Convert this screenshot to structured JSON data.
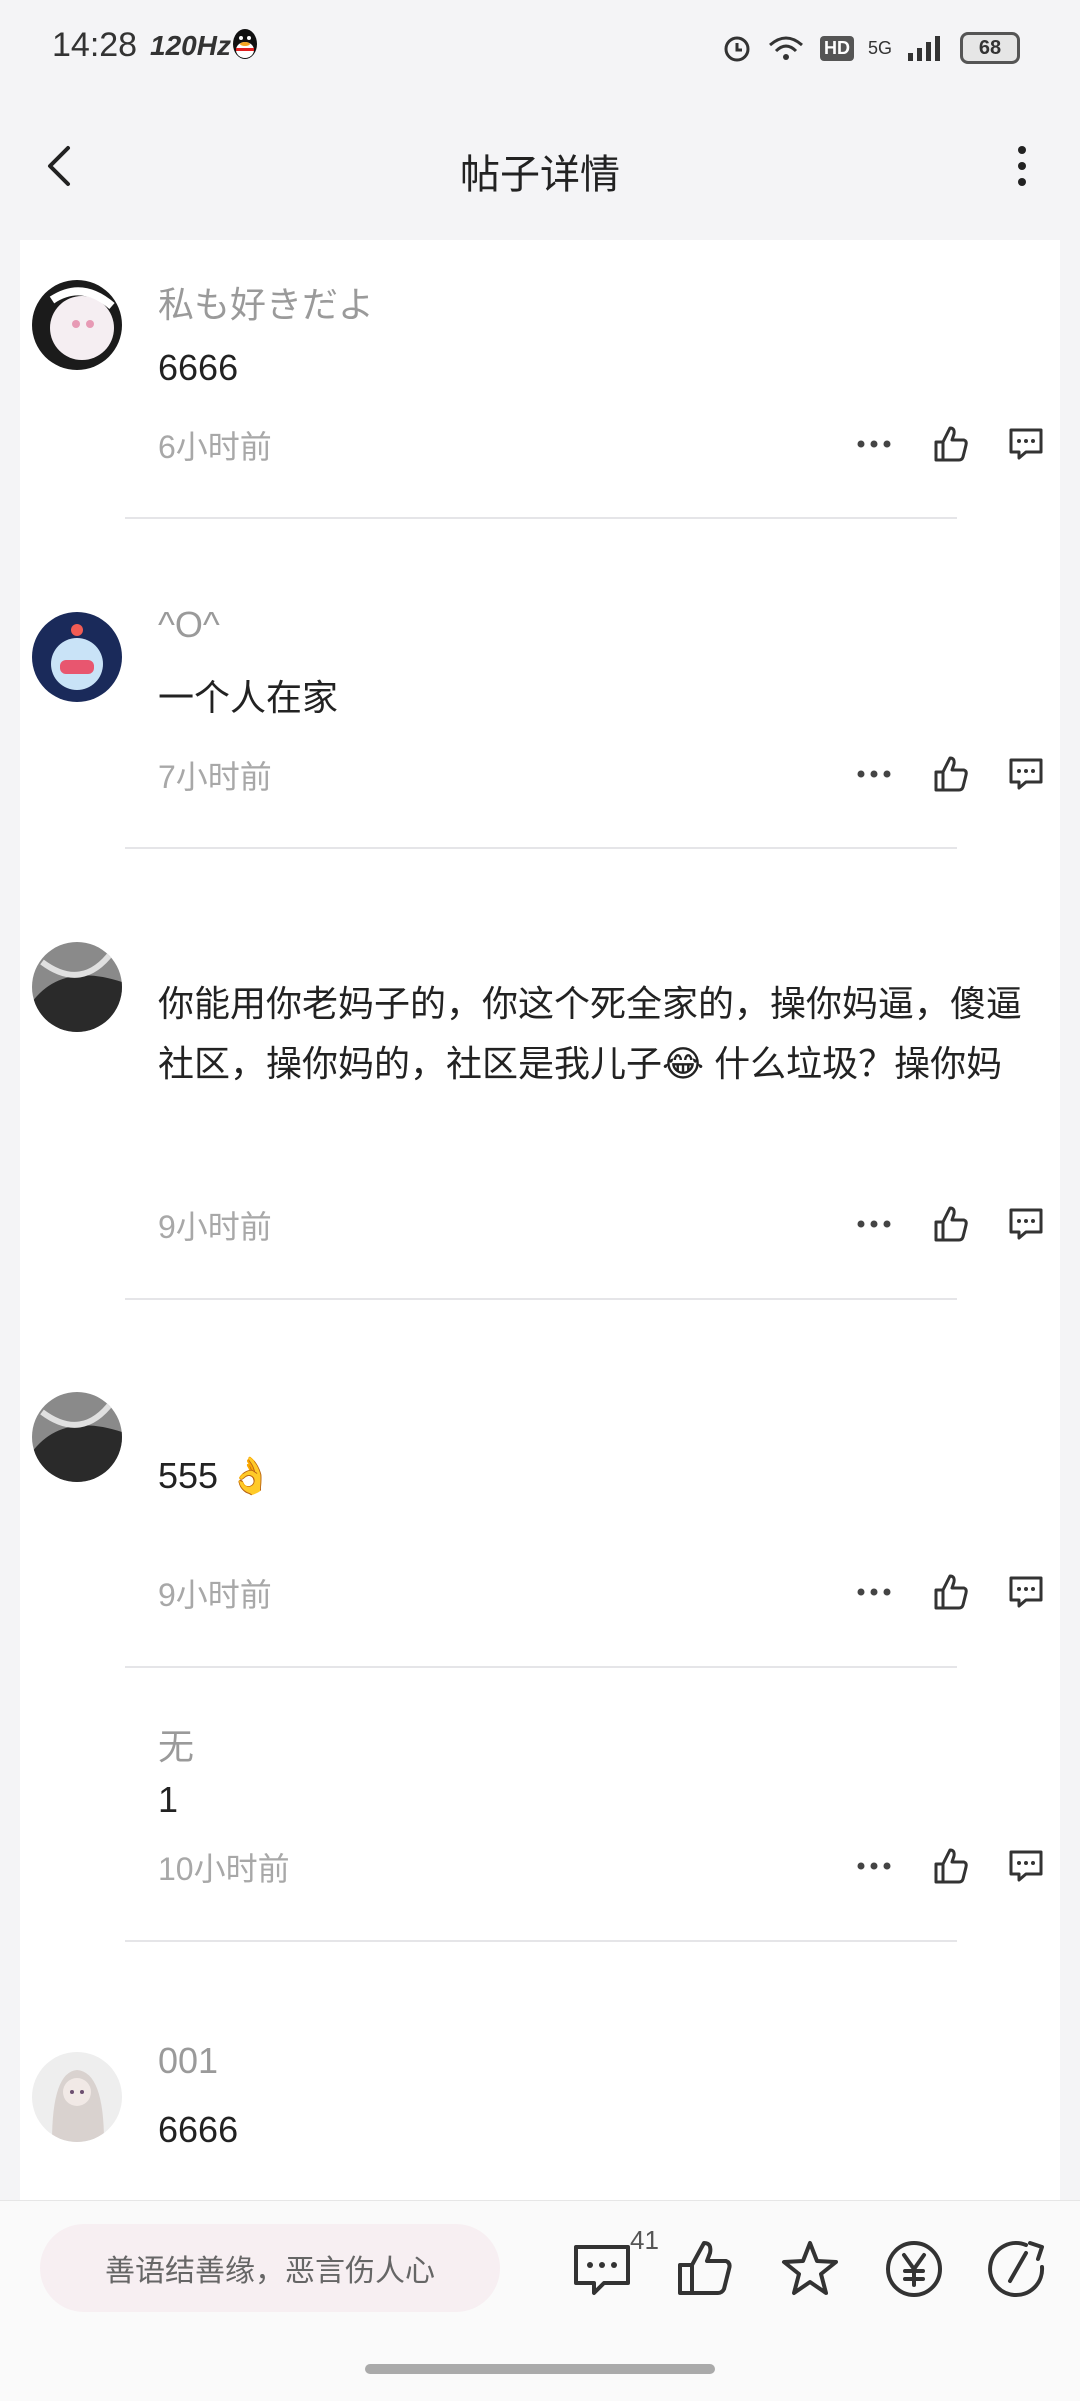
{
  "status": {
    "time": "14:28",
    "refresh": "120Hz",
    "network": "5G",
    "battery": "68",
    "hd": "HD"
  },
  "header": {
    "title": "帖子详情"
  },
  "comments": [
    {
      "name": "私も好きだよ",
      "text": "6666",
      "time": "6小时前"
    },
    {
      "name": "^O^",
      "text": "一个人在家",
      "time": "7小时前"
    },
    {
      "name": "",
      "text": "你能用你老妈子的，你这个死全家的，操你妈逼，傻逼社区，操你妈的，社区是我儿子😂 什么垃圾？操你妈",
      "time": "9小时前"
    },
    {
      "name": "",
      "text": "555 👌",
      "time": "9小时前"
    },
    {
      "name": "无",
      "text": "1",
      "time": "10小时前"
    },
    {
      "name": "001",
      "text": "6666",
      "time": ""
    }
  ],
  "bottom": {
    "placeholder": "善语结善缘，恶言伤人心",
    "comment_count": "41"
  },
  "icons": [
    "back-icon",
    "more-icon",
    "ellipsis-icon",
    "like-icon",
    "reply-icon",
    "comment-icon",
    "star-icon",
    "yuan-icon",
    "share-icon"
  ]
}
